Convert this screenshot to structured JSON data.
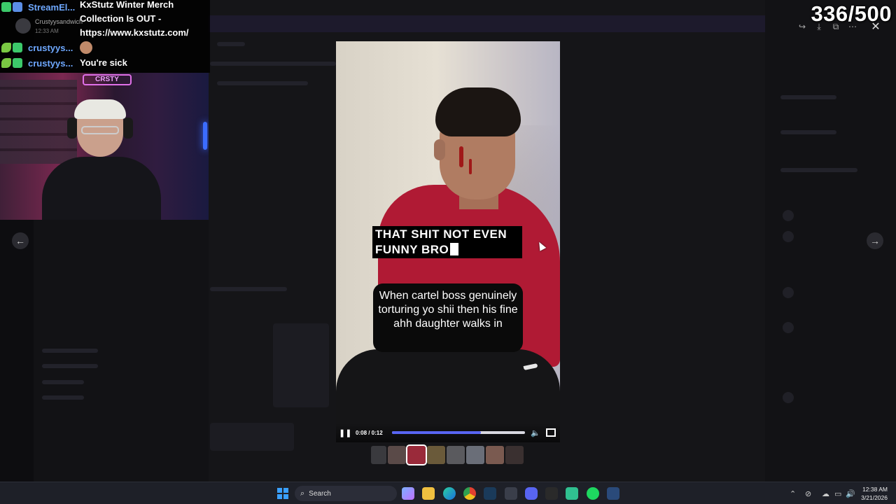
{
  "chat": {
    "messages": [
      {
        "user": "StreamEl...",
        "text": "KxStutz Winter Merch Collection Is OUT - https://www.kxstutz.com/"
      },
      {
        "user": "crustyys...",
        "text": ""
      },
      {
        "user": "crustyys...",
        "text": "You're sick"
      }
    ],
    "sub_user": "Crustyysandwich",
    "sub_time": "12:33 AM"
  },
  "webcam": {
    "sign_text": "CRSTY"
  },
  "counter": "336/500",
  "video": {
    "caption_top": "THAT SHIT NOT EVEN FUNNY BRO",
    "caption_bottom": "When cartel boss genuinely torturing yo shii then his fine ahh daughter walks in",
    "time": "0:08 / 0:12",
    "progress": 0.667
  },
  "taskbar": {
    "search_placeholder": "Search",
    "time": "12:38 AM",
    "date": "3/21/2026"
  },
  "icons": {
    "prev": "arrow-left-icon",
    "next": "arrow-right-icon",
    "close": "close-icon"
  },
  "colors": {
    "accent": "#5865f2",
    "chat_user": "#6ea8ff"
  }
}
